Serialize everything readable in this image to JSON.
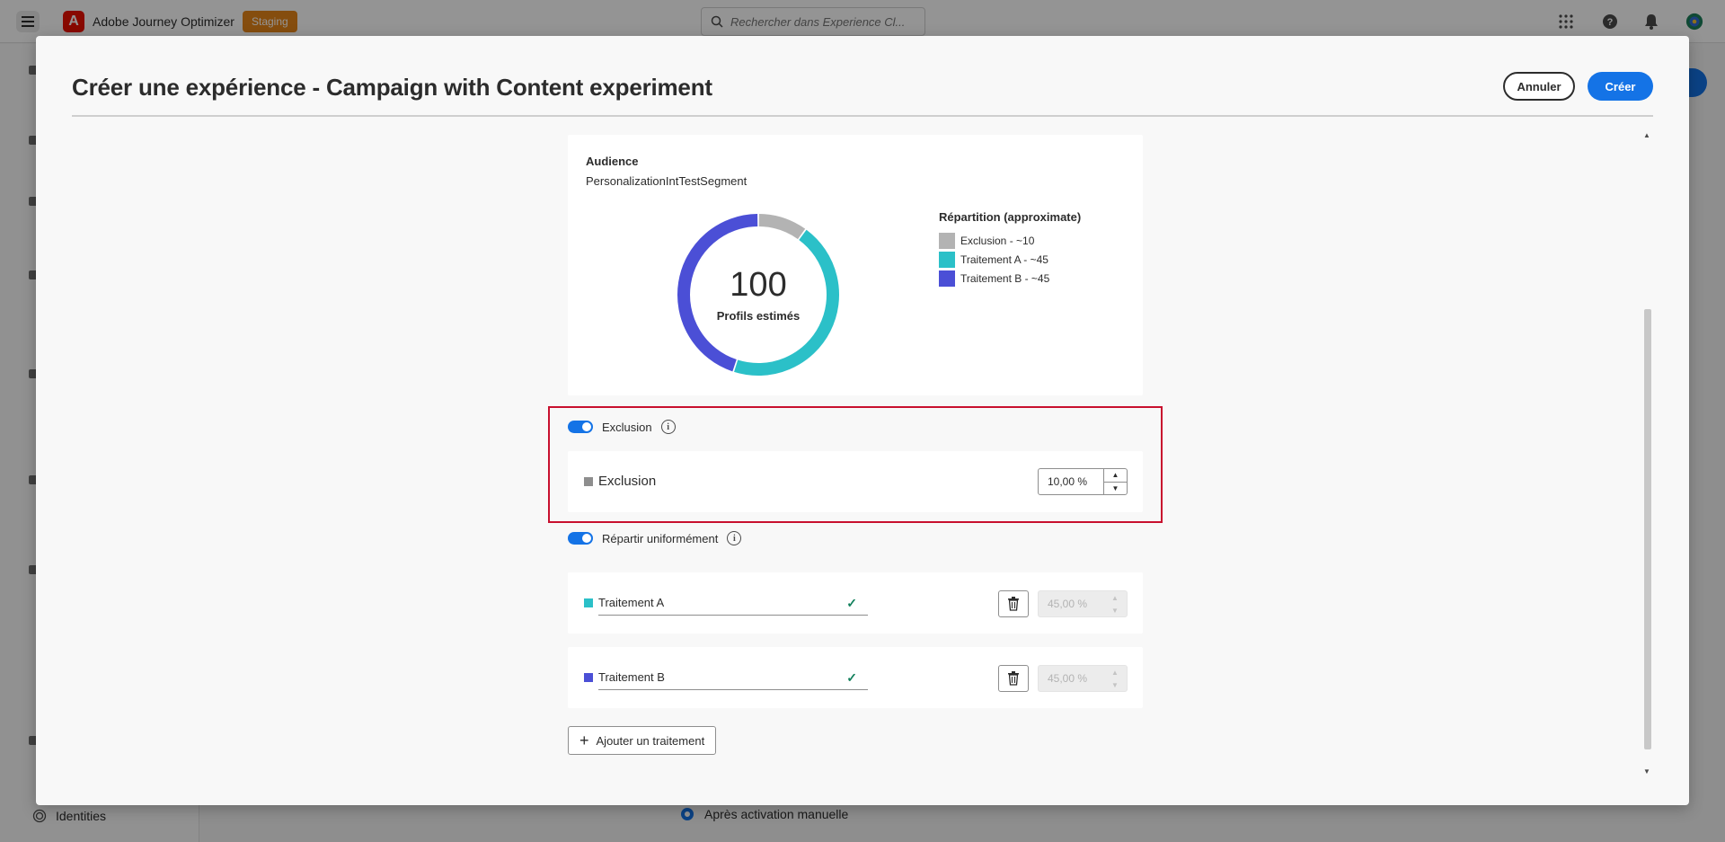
{
  "app": {
    "name": "Adobe Journey Optimizer",
    "env_badge": "Staging",
    "search_placeholder": "Rechercher dans Experience Cl..."
  },
  "sidebar": {
    "bottom_item": "Identities"
  },
  "background": {
    "radio_label": "Après activation manuelle"
  },
  "modal": {
    "title": "Créer une expérience - Campaign with Content experiment",
    "cancel_label": "Annuler",
    "create_label": "Créer"
  },
  "audience": {
    "label": "Audience",
    "name": "PersonalizationIntTestSegment",
    "profile_count": "100",
    "profile_caption": "Profils estimés",
    "legend_title": "Répartition (approximate)",
    "legend": [
      {
        "label": "Exclusion - ~10",
        "color": "#b3b3b3",
        "percent": 10
      },
      {
        "label": "Traitement A - ~45",
        "color": "#2bc0c8",
        "percent": 45
      },
      {
        "label": "Traitement B - ~45",
        "color": "#4b4fd6",
        "percent": 45
      }
    ]
  },
  "exclusion": {
    "toggle_label": "Exclusion",
    "toggle_on": true,
    "row_label": "Exclusion",
    "value": "10,00 %",
    "color": "#8e8e8e"
  },
  "distribute": {
    "toggle_label": "Répartir uniformément",
    "toggle_on": true
  },
  "treatments": [
    {
      "name": "Traitement A",
      "value": "45,00 %",
      "color": "#2bc0c8"
    },
    {
      "name": "Traitement B",
      "value": "45,00 %",
      "color": "#4b4fd6"
    }
  ],
  "add_treatment_label": "Ajouter un traitement"
}
